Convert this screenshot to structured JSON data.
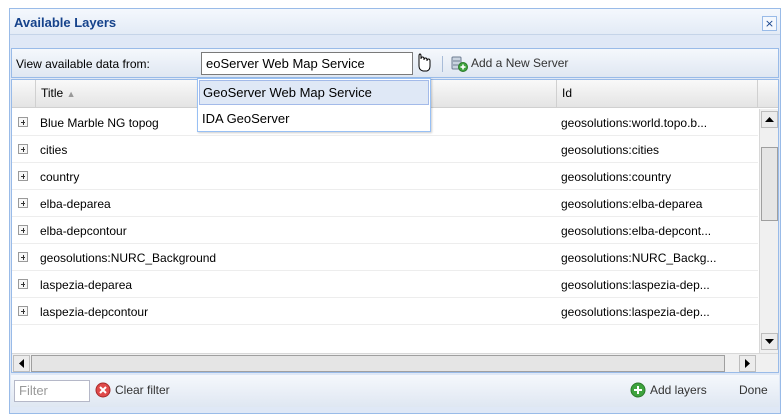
{
  "window": {
    "title": "Available Layers",
    "close_glyph": "×"
  },
  "toolbar": {
    "label": "View available data from:",
    "server_value": "eoServer Web Map Service",
    "add_server_label": "Add a New Server"
  },
  "dropdown": {
    "options": [
      "GeoServer Web Map Service",
      "IDA GeoServer"
    ]
  },
  "grid": {
    "headers": {
      "title": "Title",
      "sort_glyph": "▲",
      "id": "Id"
    },
    "rows": [
      {
        "title": "Blue Marble NG topog",
        "id": "geosolutions:world.topo.b..."
      },
      {
        "title": "cities",
        "id": "geosolutions:cities"
      },
      {
        "title": "country",
        "id": "geosolutions:country"
      },
      {
        "title": "elba-deparea",
        "id": "geosolutions:elba-deparea"
      },
      {
        "title": "elba-depcontour",
        "id": "geosolutions:elba-depcont..."
      },
      {
        "title": "geosolutions:NURC_Background",
        "id": "geosolutions:NURC_Backg..."
      },
      {
        "title": "laspezia-deparea",
        "id": "geosolutions:laspezia-dep..."
      },
      {
        "title": "laspezia-depcontour",
        "id": "geosolutions:laspezia-dep..."
      }
    ]
  },
  "bottombar": {
    "filter_placeholder": "Filter",
    "clear_filter_label": "Clear filter",
    "add_layers_label": "Add layers",
    "done_label": "Done"
  },
  "colors": {
    "header_text": "#15428b",
    "panel_border": "#99bbe8",
    "add_green": "#3ea33e",
    "clear_red": "#e04a4a"
  },
  "icons": {
    "close": "close-icon",
    "combo_trigger": "dropdown-arrow-icon",
    "add_server": "database-add-icon",
    "expander": "plus-expander-icon",
    "clear_filter": "clear-filter-icon",
    "add_layers": "add-icon"
  }
}
